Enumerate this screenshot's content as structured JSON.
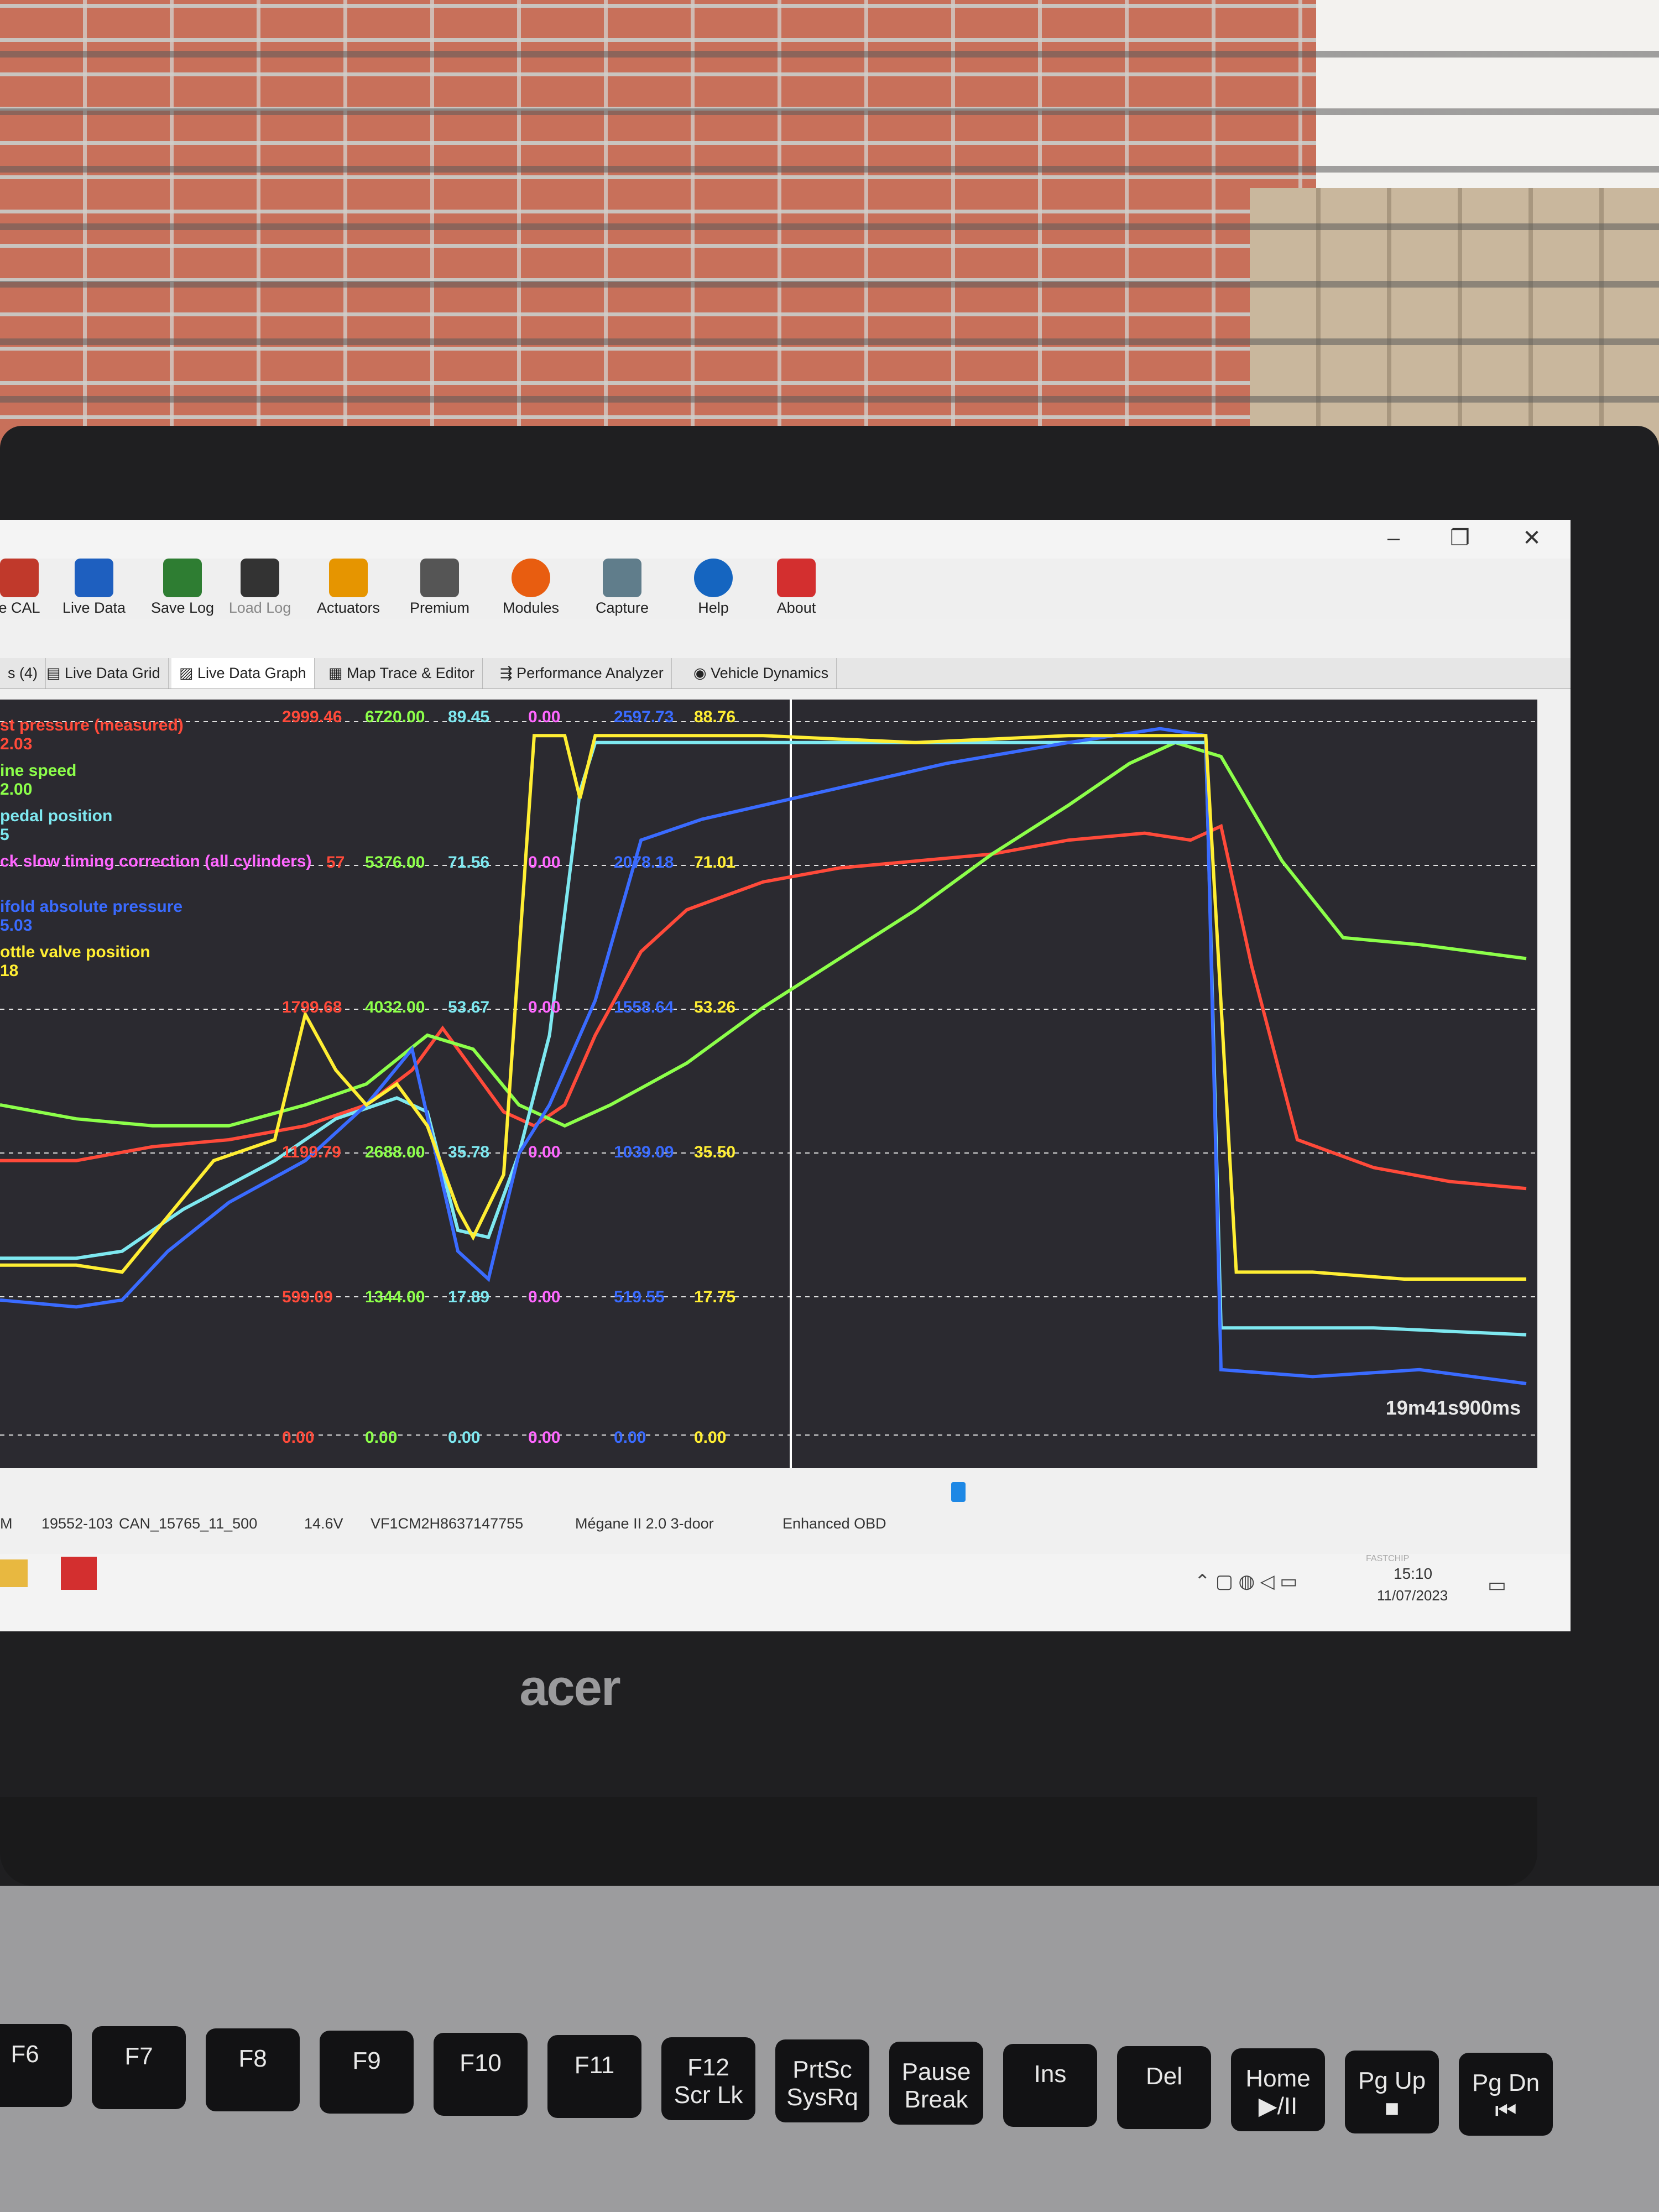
{
  "toolbar": {
    "items": [
      {
        "label": "e CAL",
        "icon": "cal-chip-icon",
        "color": "#c0392b"
      },
      {
        "label": "Live Data",
        "icon": "live-data-icon",
        "color": "#1e5fbf"
      },
      {
        "label": "Save Log",
        "icon": "save-log-icon",
        "color": "#2e7d32"
      },
      {
        "label": "Load Log",
        "icon": "load-log-icon",
        "color": "#333333"
      },
      {
        "label": "Actuators",
        "icon": "actuators-icon",
        "color": "#e69500"
      },
      {
        "label": "Premium",
        "icon": "premium-icon",
        "color": "#555555"
      },
      {
        "label": "Modules",
        "icon": "modules-gear-icon",
        "color": "#e85d10"
      },
      {
        "label": "Capture",
        "icon": "camera-icon",
        "color": "#607d8b"
      },
      {
        "label": "Help",
        "icon": "help-icon",
        "color": "#1565c0"
      },
      {
        "label": "About",
        "icon": "about-icon",
        "color": "#d32f2f"
      }
    ]
  },
  "window_buttons": {
    "minimize": "–",
    "restore": "❐",
    "close": "✕"
  },
  "tabs": [
    {
      "label": "s (4)"
    },
    {
      "label": "Live Data Grid"
    },
    {
      "label": "Live Data Graph",
      "active": true
    },
    {
      "label": "Map Trace & Editor"
    },
    {
      "label": "Performance Analyzer"
    },
    {
      "label": "Vehicle Dynamics"
    }
  ],
  "legend": [
    {
      "name": "st pressure (measured)",
      "value": "2.03",
      "color": "#ff4a3a"
    },
    {
      "name": "ine speed",
      "value": "2.00",
      "color": "#8cff4a"
    },
    {
      "name": "pedal position",
      "value": "5",
      "color": "#7ee8f0"
    },
    {
      "name": "ck slow timing correction (all cylinders)",
      "value": "",
      "color": "#ff66ff"
    },
    {
      "name": "ifold absolute pressure",
      "value": "5.03",
      "color": "#3a6bff"
    },
    {
      "name": "ottle valve position",
      "value": "18",
      "color": "#ffee33"
    }
  ],
  "scale_rows": [
    {
      "values": [
        "2999.46",
        "6720.00",
        "89.45",
        "0.00",
        "2597.73",
        "88.76"
      ]
    },
    {
      "values": [
        "57",
        "5376.00",
        "71.56",
        "0.00",
        "2078.18",
        "71.01"
      ]
    },
    {
      "values": [
        "1799.68",
        "4032.00",
        "53.67",
        "0.00",
        "1558.64",
        "53.26"
      ]
    },
    {
      "values": [
        "1199.79",
        "2688.00",
        "35.78",
        "0.00",
        "1039.09",
        "35.50"
      ]
    },
    {
      "values": [
        "599.09",
        "1344.00",
        "17.89",
        "0.00",
        "519.55",
        "17.75"
      ]
    },
    {
      "values": [
        "0.00",
        "0.00",
        "0.00",
        "0.00",
        "0.00",
        "0.00"
      ]
    }
  ],
  "cursor_time": "19m41s900ms",
  "status_bar": {
    "left": "M",
    "ecu": "19552-103",
    "cal": "CAN_15765_11_500",
    "voltage": "14.6V",
    "vin": "VF1CM2H8637147755",
    "vehicle": "Mégane II 2.0 3-door",
    "protocol": "Enhanced OBD"
  },
  "taskbar": {
    "time": "15:10",
    "date": "11/07/2023",
    "watermark": "FASTCHIP"
  },
  "laptop_brand": "acer",
  "keys": [
    {
      "top": "F6",
      "bottom": ""
    },
    {
      "top": "F7",
      "bottom": ""
    },
    {
      "top": "F8",
      "bottom": ""
    },
    {
      "top": "F9",
      "bottom": ""
    },
    {
      "top": "F10",
      "bottom": ""
    },
    {
      "top": "F11",
      "bottom": ""
    },
    {
      "top": "F12",
      "bottom": "Scr Lk"
    },
    {
      "top": "PrtSc",
      "bottom": "SysRq"
    },
    {
      "top": "Pause",
      "bottom": "Break"
    },
    {
      "top": "Ins",
      "bottom": ""
    },
    {
      "top": "Del",
      "bottom": ""
    },
    {
      "top": "Home",
      "bottom": "▶/II"
    },
    {
      "top": "Pg Up",
      "bottom": "■"
    },
    {
      "top": "Pg Dn",
      "bottom": "⏮"
    }
  ],
  "series": [
    {
      "name": "boost",
      "color": "#ff4a3a",
      "points": [
        [
          0,
          0.63
        ],
        [
          0.05,
          0.63
        ],
        [
          0.1,
          0.61
        ],
        [
          0.15,
          0.6
        ],
        [
          0.2,
          0.58
        ],
        [
          0.24,
          0.55
        ],
        [
          0.27,
          0.5
        ],
        [
          0.29,
          0.44
        ],
        [
          0.31,
          0.5
        ],
        [
          0.33,
          0.56
        ],
        [
          0.35,
          0.58
        ],
        [
          0.37,
          0.55
        ],
        [
          0.39,
          0.45
        ],
        [
          0.42,
          0.33
        ],
        [
          0.45,
          0.27
        ],
        [
          0.5,
          0.23
        ],
        [
          0.55,
          0.21
        ],
        [
          0.6,
          0.2
        ],
        [
          0.65,
          0.19
        ],
        [
          0.7,
          0.17
        ],
        [
          0.75,
          0.16
        ],
        [
          0.78,
          0.17
        ],
        [
          0.8,
          0.15
        ],
        [
          0.82,
          0.35
        ],
        [
          0.85,
          0.6
        ],
        [
          0.9,
          0.64
        ],
        [
          0.95,
          0.66
        ],
        [
          1,
          0.67
        ]
      ]
    },
    {
      "name": "rpm",
      "color": "#8cff4a",
      "points": [
        [
          0,
          0.55
        ],
        [
          0.05,
          0.57
        ],
        [
          0.1,
          0.58
        ],
        [
          0.15,
          0.58
        ],
        [
          0.2,
          0.55
        ],
        [
          0.24,
          0.52
        ],
        [
          0.28,
          0.45
        ],
        [
          0.31,
          0.47
        ],
        [
          0.34,
          0.55
        ],
        [
          0.37,
          0.58
        ],
        [
          0.4,
          0.55
        ],
        [
          0.45,
          0.49
        ],
        [
          0.5,
          0.41
        ],
        [
          0.55,
          0.34
        ],
        [
          0.6,
          0.27
        ],
        [
          0.65,
          0.19
        ],
        [
          0.7,
          0.12
        ],
        [
          0.74,
          0.06
        ],
        [
          0.77,
          0.03
        ],
        [
          0.8,
          0.05
        ],
        [
          0.84,
          0.2
        ],
        [
          0.88,
          0.31
        ],
        [
          0.93,
          0.32
        ],
        [
          1,
          0.34
        ]
      ]
    },
    {
      "name": "pedal",
      "color": "#7ee8f0",
      "points": [
        [
          0,
          0.77
        ],
        [
          0.05,
          0.77
        ],
        [
          0.08,
          0.76
        ],
        [
          0.12,
          0.7
        ],
        [
          0.18,
          0.63
        ],
        [
          0.22,
          0.57
        ],
        [
          0.26,
          0.54
        ],
        [
          0.28,
          0.56
        ],
        [
          0.3,
          0.73
        ],
        [
          0.32,
          0.74
        ],
        [
          0.34,
          0.62
        ],
        [
          0.36,
          0.45
        ],
        [
          0.38,
          0.1
        ],
        [
          0.39,
          0.03
        ],
        [
          0.5,
          0.03
        ],
        [
          0.6,
          0.03
        ],
        [
          0.7,
          0.03
        ],
        [
          0.79,
          0.03
        ],
        [
          0.8,
          0.87
        ],
        [
          0.85,
          0.87
        ],
        [
          0.9,
          0.87
        ],
        [
          1,
          0.88
        ]
      ]
    },
    {
      "name": "map",
      "color": "#3a6bff",
      "points": [
        [
          0,
          0.83
        ],
        [
          0.05,
          0.84
        ],
        [
          0.08,
          0.83
        ],
        [
          0.11,
          0.76
        ],
        [
          0.15,
          0.69
        ],
        [
          0.2,
          0.63
        ],
        [
          0.24,
          0.55
        ],
        [
          0.27,
          0.47
        ],
        [
          0.3,
          0.76
        ],
        [
          0.32,
          0.8
        ],
        [
          0.34,
          0.62
        ],
        [
          0.36,
          0.55
        ],
        [
          0.39,
          0.4
        ],
        [
          0.42,
          0.17
        ],
        [
          0.46,
          0.14
        ],
        [
          0.5,
          0.12
        ],
        [
          0.56,
          0.09
        ],
        [
          0.62,
          0.06
        ],
        [
          0.7,
          0.03
        ],
        [
          0.76,
          0.01
        ],
        [
          0.79,
          0.02
        ],
        [
          0.8,
          0.93
        ],
        [
          0.86,
          0.94
        ],
        [
          0.93,
          0.93
        ],
        [
          1,
          0.95
        ]
      ]
    },
    {
      "name": "throttle",
      "color": "#ffee33",
      "points": [
        [
          0,
          0.78
        ],
        [
          0.05,
          0.78
        ],
        [
          0.08,
          0.79
        ],
        [
          0.11,
          0.71
        ],
        [
          0.14,
          0.63
        ],
        [
          0.18,
          0.6
        ],
        [
          0.2,
          0.42
        ],
        [
          0.22,
          0.5
        ],
        [
          0.24,
          0.55
        ],
        [
          0.26,
          0.52
        ],
        [
          0.28,
          0.58
        ],
        [
          0.3,
          0.7
        ],
        [
          0.31,
          0.74
        ],
        [
          0.33,
          0.65
        ],
        [
          0.35,
          0.02
        ],
        [
          0.37,
          0.02
        ],
        [
          0.38,
          0.11
        ],
        [
          0.39,
          0.02
        ],
        [
          0.45,
          0.02
        ],
        [
          0.5,
          0.02
        ],
        [
          0.6,
          0.03
        ],
        [
          0.7,
          0.02
        ],
        [
          0.79,
          0.02
        ],
        [
          0.81,
          0.79
        ],
        [
          0.86,
          0.79
        ],
        [
          0.92,
          0.8
        ],
        [
          1,
          0.8
        ]
      ]
    }
  ]
}
